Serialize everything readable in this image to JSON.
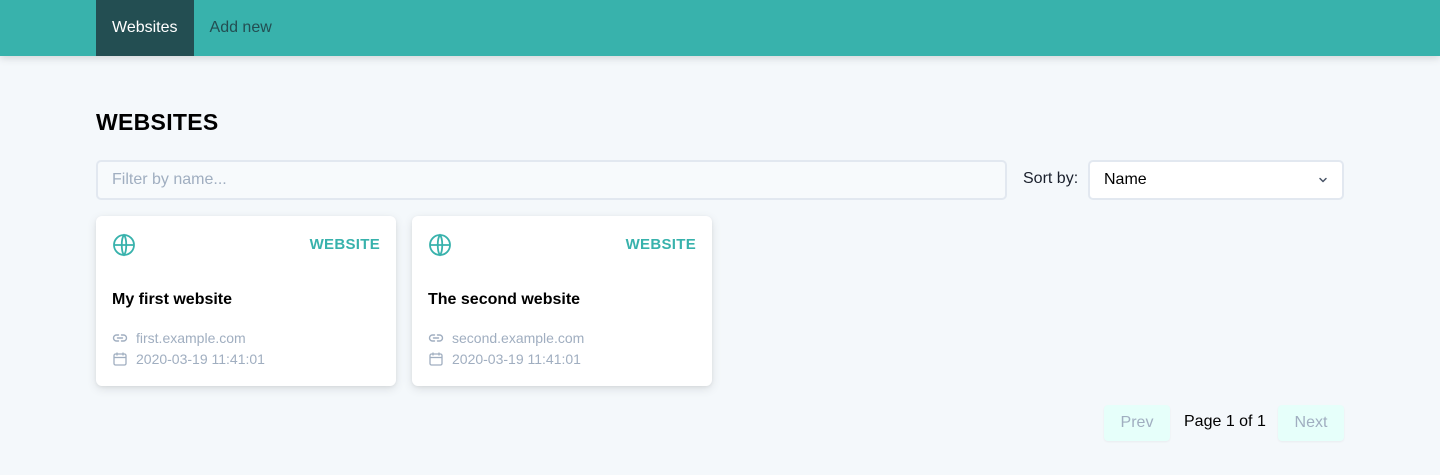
{
  "nav": {
    "items": [
      {
        "label": "Websites",
        "active": true
      },
      {
        "label": "Add new",
        "active": false
      }
    ]
  },
  "page": {
    "title": "WEBSITES"
  },
  "filter": {
    "placeholder": "Filter by name...",
    "value": ""
  },
  "sort": {
    "label": "Sort by:",
    "selected": "Name"
  },
  "cards": [
    {
      "type": "WEBSITE",
      "name": "My first website",
      "url": "first.example.com",
      "date": "2020-03-19 11:41:01",
      "icon": "globe-icon"
    },
    {
      "type": "WEBSITE",
      "name": "The second website",
      "url": "second.example.com",
      "date": "2020-03-19 11:41:01",
      "icon": "globe-icon"
    }
  ],
  "pagination": {
    "prev_label": "Prev",
    "info": "Page 1 of 1",
    "next_label": "Next"
  },
  "colors": {
    "accent": "#38b2ac",
    "nav_active": "#234e52",
    "background": "#f4f8fb",
    "muted": "#a0aec0"
  }
}
